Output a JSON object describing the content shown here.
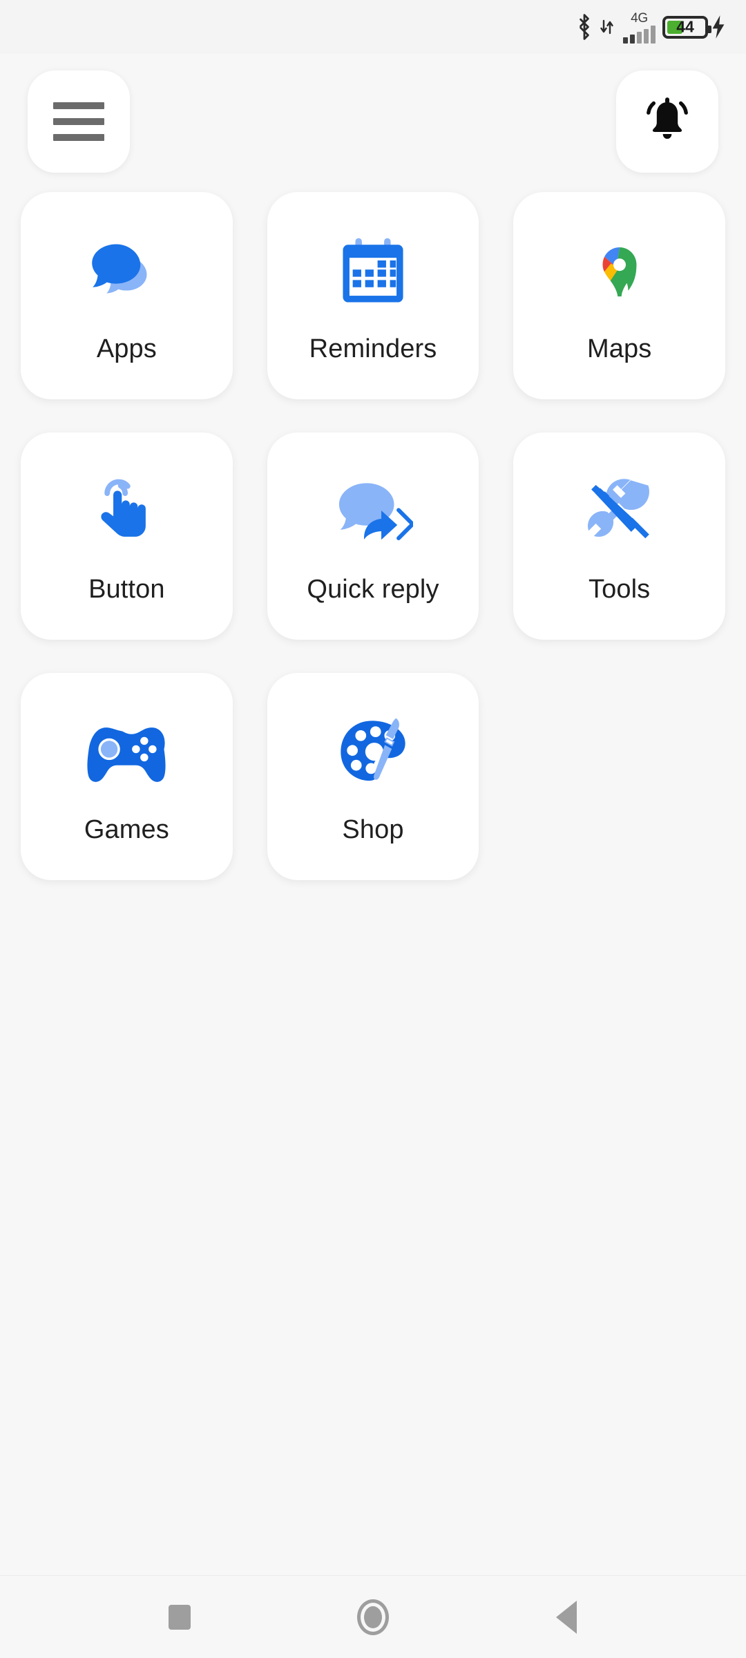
{
  "status_bar": {
    "bluetooth_icon": "bluetooth-icon",
    "network_type": "4G",
    "signal_icon": "signal-bars-icon",
    "data_icon": "data-transfer-icon",
    "battery_percent": "44",
    "battery_level": 42,
    "battery_color": "#4caf2f",
    "charging_icon": "lightning-bolt-icon"
  },
  "header": {
    "menu_button": "menu-button",
    "menu_icon": "hamburger-menu-icon",
    "notifications_button": "notifications-button",
    "notifications_icon": "bell-icon"
  },
  "theme": {
    "background": "#f7f7f7",
    "card_background": "#ffffff",
    "accent_blue": "#1a73e8",
    "accent_blue_light": "#8ab4f8",
    "label_color": "#1f1f1f"
  },
  "grid": {
    "items": [
      {
        "label": "Apps",
        "icon": "chat-bubbles-icon"
      },
      {
        "label": "Reminders",
        "icon": "calendar-icon"
      },
      {
        "label": "Maps",
        "icon": "google-maps-pin-icon"
      },
      {
        "label": "Button",
        "icon": "tap-hand-icon"
      },
      {
        "label": "Quick reply",
        "icon": "speech-bubble-reply-arrow-icon"
      },
      {
        "label": "Tools",
        "icon": "wrench-screwdriver-icon"
      },
      {
        "label": "Games",
        "icon": "gamepad-icon"
      },
      {
        "label": "Shop",
        "icon": "paint-palette-brush-icon"
      }
    ]
  },
  "nav_bar": {
    "recents": "recents-button",
    "home": "home-button",
    "back": "back-button"
  }
}
